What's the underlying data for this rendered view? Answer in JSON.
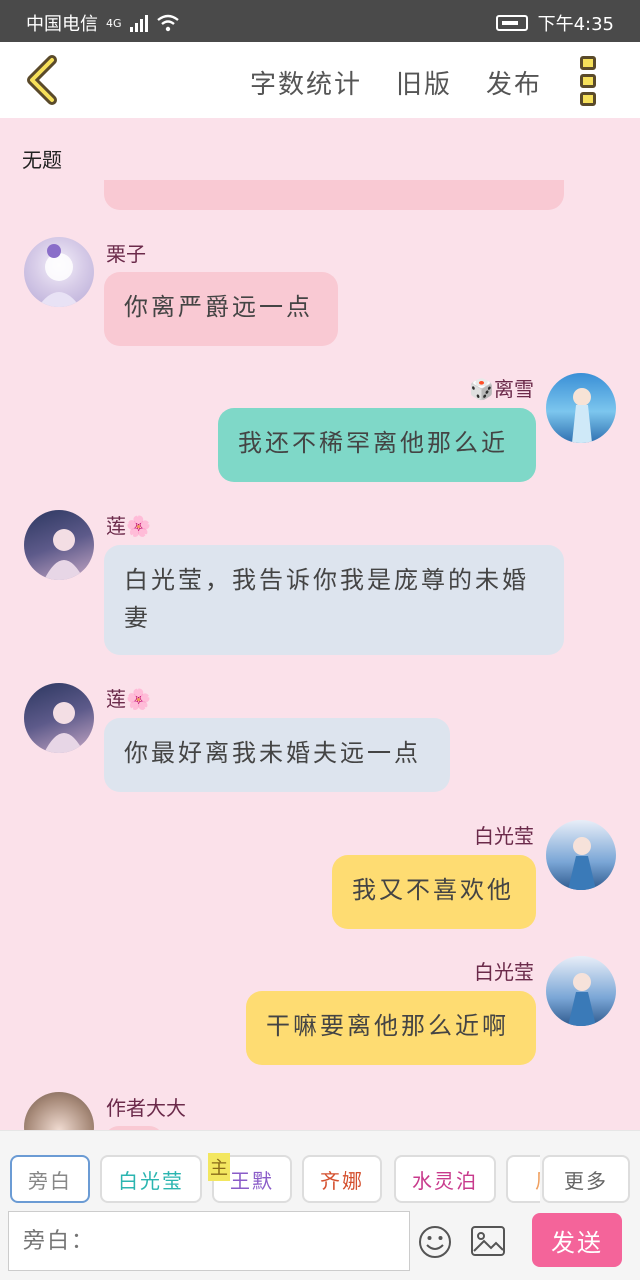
{
  "status_bar": {
    "carrier": "中国电信",
    "network": "4G",
    "time": "下午4:35"
  },
  "header": {
    "back_icon": "chevron-left-icon",
    "actions": [
      "字数统计",
      "旧版",
      "发布"
    ],
    "menu_icon": "more-vertical-icon"
  },
  "chat": {
    "title": "无题",
    "messages": [
      {
        "side": "left",
        "name": "栗子",
        "text": "你离严爵远一点",
        "bubble_color": "#f9c9d3"
      },
      {
        "side": "right",
        "name": "🎲离雪",
        "text": "我还不稀罕离他那么近",
        "bubble_color": "#7fd8c8"
      },
      {
        "side": "left",
        "name": "莲🌸",
        "text": "白光莹，我告诉你我是庞尊的未婚妻",
        "bubble_color": "#dde4ee"
      },
      {
        "side": "left",
        "name": "莲🌸",
        "text": "你最好离我未婚夫远一点",
        "bubble_color": "#dde4ee"
      },
      {
        "side": "right",
        "name": "白光莹",
        "text": "我又不喜欢他",
        "bubble_color": "#fedc72"
      },
      {
        "side": "right",
        "name": "白光莹",
        "text": "干嘛要离他那么近啊",
        "bubble_color": "#fedc72"
      },
      {
        "side": "left",
        "name": "作者大大",
        "text": "",
        "bubble_color": "#f9c9d3"
      }
    ]
  },
  "toolbar": {
    "roles": [
      {
        "label": "旁白",
        "color": "#888888",
        "active": true
      },
      {
        "label": "白光莹",
        "color": "#2bb5b0",
        "active": false
      },
      {
        "label": "王默",
        "color": "#8a5cc8",
        "active": false
      },
      {
        "label": "齐娜",
        "color": "#d4502e",
        "active": false
      },
      {
        "label": "水灵泊",
        "color": "#c83a8c",
        "active": false
      },
      {
        "label": "风",
        "color": "#f0a060",
        "active": false
      }
    ],
    "protagonist_marker": "主",
    "more_label": "更多",
    "input_placeholder": "旁白：",
    "send_label": "发送"
  }
}
